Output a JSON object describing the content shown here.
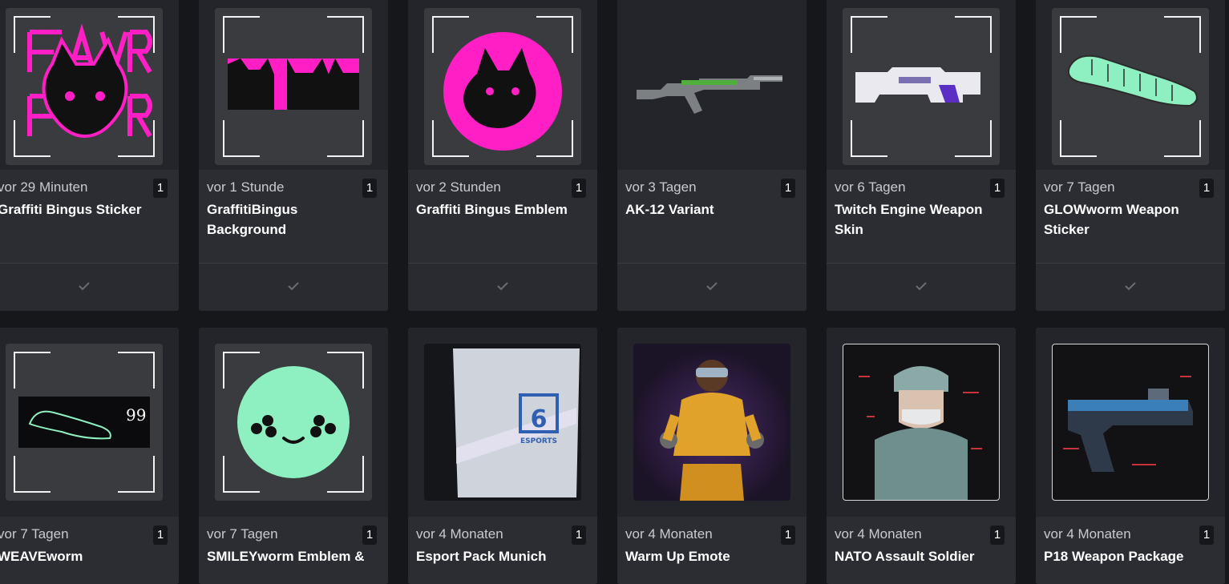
{
  "colors": {
    "accent_pink": "#ff1fc4",
    "accent_mint": "#8ef0c0",
    "card_bg": "#24252b"
  },
  "items": [
    {
      "time": "vor 29 Minuten",
      "qty": "1",
      "name": "Graffiti Bingus Sticker",
      "icon": "graffiti-bingus-sticker-icon",
      "status_icon": "check-icon"
    },
    {
      "time": "vor 1 Stunde",
      "qty": "1",
      "name": "GraffitiBingus Background",
      "icon": "graffiti-bingus-background-icon",
      "status_icon": "check-icon"
    },
    {
      "time": "vor 2 Stunden",
      "qty": "1",
      "name": "Graffiti Bingus Emblem",
      "icon": "graffiti-bingus-emblem-icon",
      "status_icon": "check-icon"
    },
    {
      "time": "vor 3 Tagen",
      "qty": "1",
      "name": "AK-12 Variant",
      "icon": "rifle-icon",
      "status_icon": "check-icon"
    },
    {
      "time": "vor 6 Tagen",
      "qty": "1",
      "name": "Twitch Engine Weapon Skin",
      "icon": "weapon-skin-icon",
      "status_icon": "check-icon"
    },
    {
      "time": "vor 7 Tagen",
      "qty": "1",
      "name": "GLOWworm Weapon Sticker",
      "icon": "glowworm-icon",
      "status_icon": "check-icon"
    },
    {
      "time": "vor 7 Tagen",
      "qty": "1",
      "name": "WEAVEworm",
      "icon": "weaveworm-icon",
      "badge": "99"
    },
    {
      "time": "vor 7 Tagen",
      "qty": "1",
      "name": "SMILEYworm Emblem &",
      "icon": "smiley-icon"
    },
    {
      "time": "vor 4 Monaten",
      "qty": "1",
      "name": "Esport Pack Munich",
      "icon": "esport-pack-icon",
      "pack_number": "6",
      "pack_label": "ESPORTS"
    },
    {
      "time": "vor 4 Monaten",
      "qty": "1",
      "name": "Warm Up Emote",
      "icon": "operator-emote-icon"
    },
    {
      "time": "vor 4 Monaten",
      "qty": "1",
      "name": "NATO Assault Soldier",
      "icon": "soldier-icon"
    },
    {
      "time": "vor 4 Monaten",
      "qty": "1",
      "name": "P18 Weapon Package",
      "icon": "pistol-icon"
    }
  ]
}
